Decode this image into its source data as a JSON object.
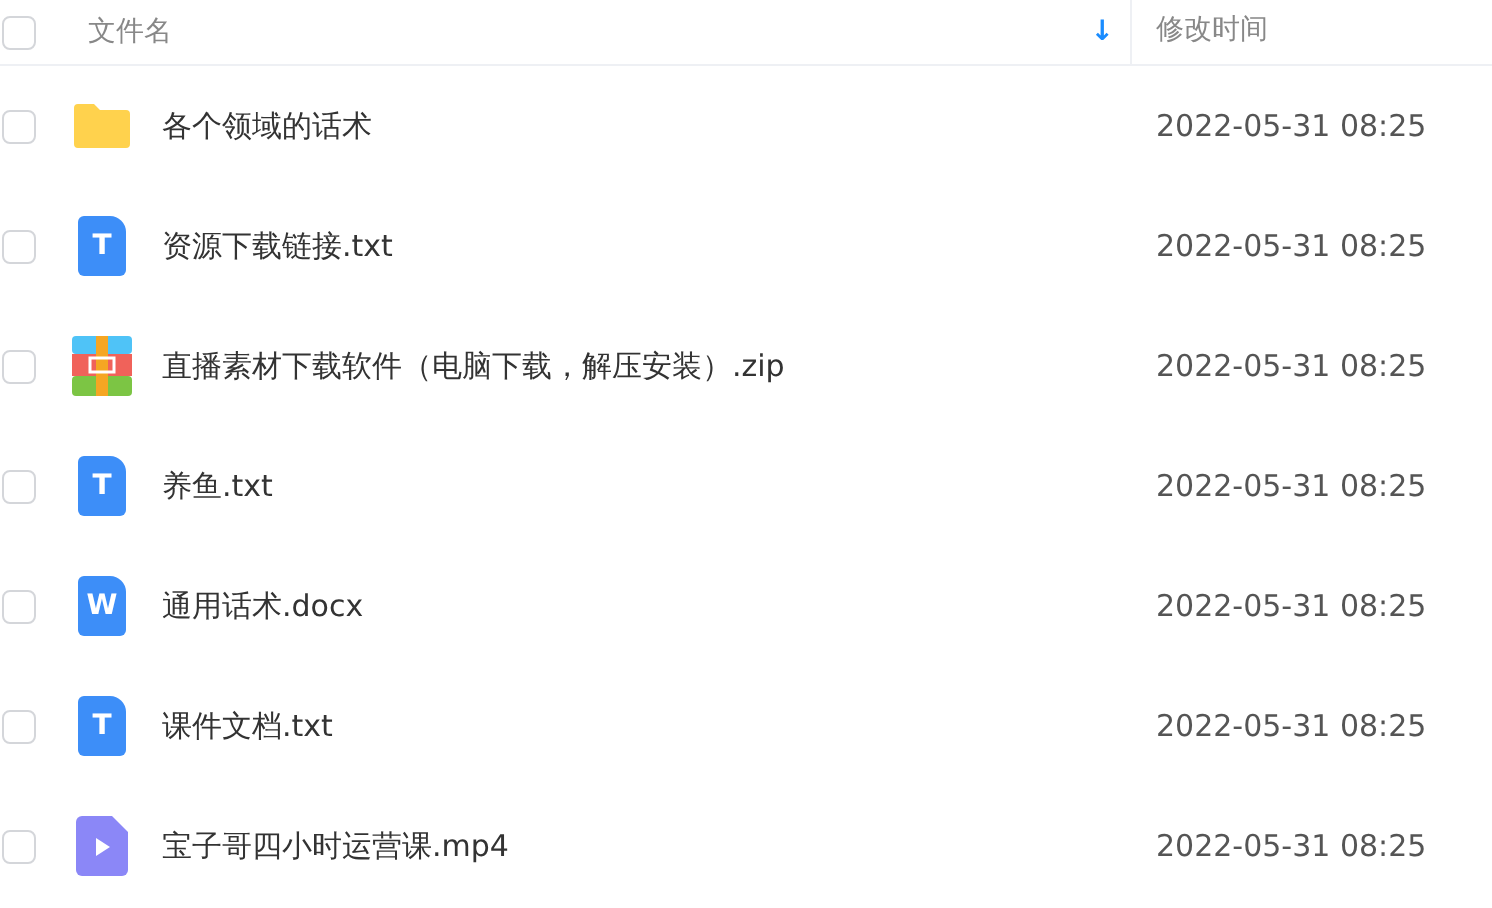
{
  "header": {
    "checked": false,
    "name_label": "文件名",
    "sort_arrow": "↓",
    "time_label": "修改时间"
  },
  "files": [
    {
      "kind": "folder",
      "name": "各个领域的话术",
      "time": "2022-05-31 08:25",
      "checked": false
    },
    {
      "kind": "txt",
      "icon_letter": "T",
      "name": "资源下载链接.txt",
      "time": "2022-05-31 08:25",
      "checked": false
    },
    {
      "kind": "zip",
      "name": "直播素材下载软件（电脑下载，解压安装）.zip",
      "time": "2022-05-31 08:25",
      "checked": false
    },
    {
      "kind": "txt",
      "icon_letter": "T",
      "name": "养鱼.txt",
      "time": "2022-05-31 08:25",
      "checked": false
    },
    {
      "kind": "doc",
      "icon_letter": "W",
      "name": "通用话术.docx",
      "time": "2022-05-31 08:25",
      "checked": false
    },
    {
      "kind": "txt",
      "icon_letter": "T",
      "name": "课件文档.txt",
      "time": "2022-05-31 08:25",
      "checked": false
    },
    {
      "kind": "video",
      "name": "宝子哥四小时运营课.mp4",
      "time": "2022-05-31 08:25",
      "checked": false
    }
  ]
}
